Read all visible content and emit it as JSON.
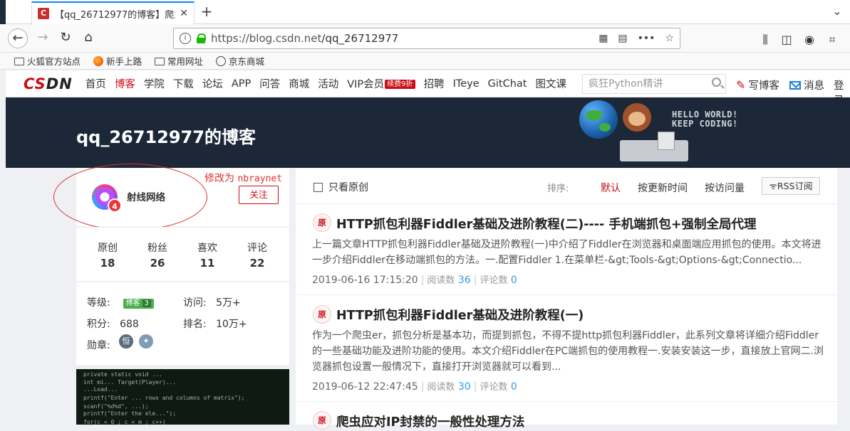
{
  "browser": {
    "tab_title": "【qq_26712977的博客】爬虫",
    "tab_close": "✕",
    "new_tab": "+",
    "url_host": "https://blog.csdn.net",
    "url_path": "/qq_26712977",
    "url_more": "•••",
    "bookmarks": [
      {
        "label": "火狐官方站点",
        "icon": "folder-icon"
      },
      {
        "label": "新手上路",
        "icon": "firefox-icon"
      },
      {
        "label": "常用网址",
        "icon": "folder-icon"
      },
      {
        "label": "京东商城",
        "icon": "globe-icon"
      }
    ]
  },
  "csdn_nav": {
    "logo_red": "CS",
    "logo_dark": "DN",
    "items": [
      "首页",
      "博客",
      "学院",
      "下载",
      "论坛",
      "APP",
      "问答",
      "商城",
      "活动",
      "VIP会员",
      "招聘",
      "ITeye",
      "GitChat",
      "图文课"
    ],
    "active_index": 1,
    "vip_badge": "续费9折",
    "search_placeholder": "疯狂Python精讲",
    "write_blog": "写博客",
    "messages": "消息",
    "login": "登录"
  },
  "banner": {
    "blog_title": "qq_26712977的博客",
    "hello_line1": "HELLO WORLD!",
    "hello_line2": "KEEP CODING!"
  },
  "profile": {
    "username": "射线网络",
    "level_badge": "4",
    "follow_label": "关注",
    "annotation_prefix": "修改为 ",
    "annotation_name": "nbraynet"
  },
  "stats": [
    {
      "label": "原创",
      "value": "18"
    },
    {
      "label": "粉丝",
      "value": "26"
    },
    {
      "label": "喜欢",
      "value": "11"
    },
    {
      "label": "评论",
      "value": "22"
    }
  ],
  "grade": {
    "level_label": "等级:",
    "level_badge_text": "博客",
    "level_badge_num": "3",
    "visits_label": "访问:",
    "visits_value": "5万+",
    "points_label": "积分:",
    "points_value": "688",
    "rank_label": "排名:",
    "rank_value": "10万+",
    "medals_label": "勋章:"
  },
  "filter": {
    "only_original": "只看原创",
    "sort_label": "排序:",
    "sort_default": "默认",
    "sort_updated": "按更新时间",
    "sort_visits": "按访问量",
    "rss": "RSS订阅"
  },
  "colors": {
    "accent": "#ca0c16",
    "link_blue": "#3399ea",
    "banner_bg": "#1c2838"
  },
  "articles": [
    {
      "tag": "原",
      "title": "HTTP抓包利器Fiddler基础及进阶教程(二)---- 手机端抓包+强制全局代理",
      "desc": "上一篇文章HTTP抓包利器Fiddler基础及进阶教程(一)中介绍了Fiddler在浏览器和桌面端应用抓包的使用。本文将进一步介绍Fiddler在移动端抓包的方法。一.配置Fiddler 1.在菜单栏-&gt;Tools-&gt;Options-&gt;Connectio...",
      "date": "2019-06-16 17:15:20",
      "reads_label": "阅读数",
      "reads": "36",
      "comments_label": "评论数",
      "comments": "0"
    },
    {
      "tag": "原",
      "title": "HTTP抓包利器Fiddler基础及进阶教程(一)",
      "desc": "作为一个爬虫er，抓包分析是基本功，而提到抓包，不得不提http抓包利器Fiddler，此系列文章将详细介绍Fiddler的一些基础功能及进阶功能的使用。本文介绍Fiddler在PC端抓包的使用教程一.安装安装这一步，直接放上官网二.浏览器抓包设置一般情况下，直接打开浏览器就可以看到...",
      "date": "2019-06-12 22:47:45",
      "reads_label": "阅读数",
      "reads": "30",
      "comments_label": "评论数",
      "comments": "0"
    },
    {
      "tag": "原",
      "title": "爬虫应对IP封禁的一般性处理方法"
    }
  ]
}
